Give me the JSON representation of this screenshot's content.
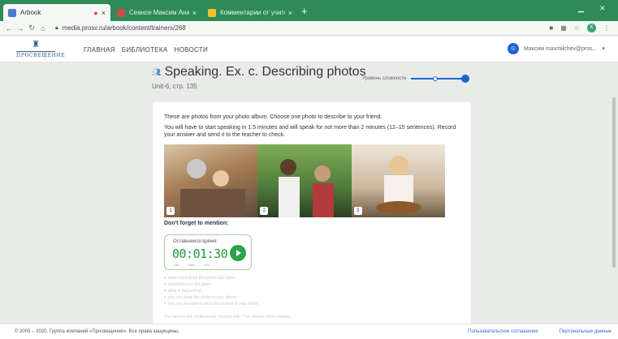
{
  "browser": {
    "tabs": [
      {
        "title": "Arbook",
        "close": "×",
        "icon_color": "#4a7bd0",
        "active": true
      },
      {
        "title": "Сеансе Максим Анатолевич",
        "close": "×",
        "icon_color": "#d04a4a",
        "active": false
      },
      {
        "title": "Комментарии от учителей - Go",
        "close": "×",
        "icon_color": "#f2c12e",
        "active": false
      }
    ],
    "new_tab": "+",
    "address": "media.prosv.ru/arbook/content/trainers/268",
    "profile_initial": "K"
  },
  "site": {
    "logo_text": "ПРОСВЕЩЕНИЕ",
    "nav": [
      {
        "label": "ГЛАВНАЯ"
      },
      {
        "label": "БИБЛИОТЕКА"
      },
      {
        "label": "НОВОСТИ"
      }
    ],
    "user_name": "Максим maxmilchev@pros..."
  },
  "page": {
    "title": "Speaking. Ex. c. Describing photos",
    "subtitle": "Unit-6, стр. 135",
    "difficulty_label": "Уровень сложности"
  },
  "task": {
    "intro": "These are photos from your photo album. Choose one photo to describe to your friend.",
    "instructions": "You will have to start speaking in 1.5 minutes and will speak for not more than 2 minutes (12–15 sentences). Record your answer and send it to the teacher to check.",
    "photos": [
      {
        "number": "1",
        "bg": "#a77d55"
      },
      {
        "number": "2",
        "bg": "#4f7a3a"
      },
      {
        "number": "3",
        "bg": "#b9a58a"
      }
    ],
    "mention_heading": "Don't forget to mention:",
    "timer": {
      "label": "Оставшееся время:",
      "value": "00:01:30",
      "units": [
        "час",
        "мин",
        "сек"
      ]
    },
    "points": [
      "where and when the photo was taken",
      "what/who is in the photo",
      "what is happening",
      "why you keep the photo in your album",
      "why you decided to show the picture to your friend"
    ],
    "faded_line": "You have to talk continuously, starting with: \"I've chosen photo number ...\""
  },
  "footer": {
    "copyright": "© 2005 – 2020. Группа компаний «Просвещение». Все права защищены.",
    "links": [
      {
        "label": "Пользовательское соглашение"
      },
      {
        "label": "Персональные данные"
      }
    ]
  },
  "colors": {
    "chrome_green": "#2e8b57",
    "accent_blue": "#1f63d6",
    "timer_green": "#1d9a3c"
  }
}
